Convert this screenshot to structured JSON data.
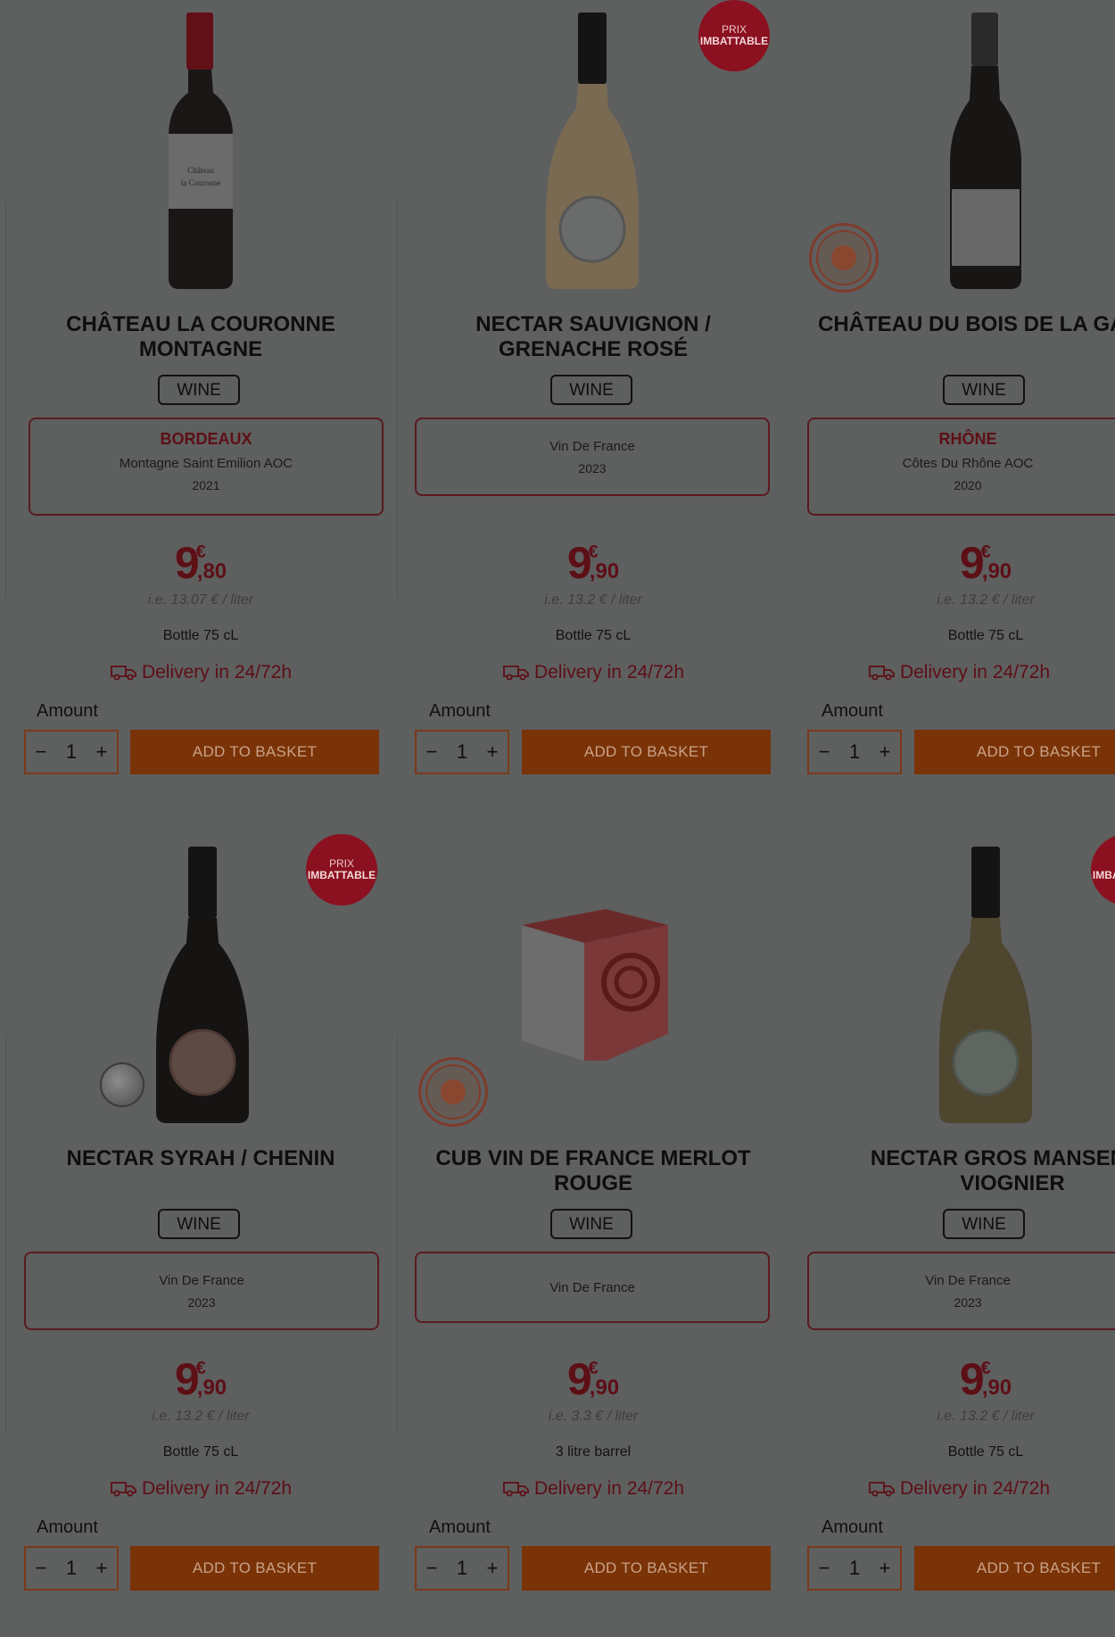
{
  "colors": {
    "overlay_bg": "#5e5f5f",
    "brand_red": "#5d0f16",
    "button_orange": "#7a3207",
    "badge_red": "#8b1020"
  },
  "badge": {
    "line1": "PRIX",
    "line2": "IMBATTABLE"
  },
  "amount_label": "Amount",
  "add_to_basket": "ADD TO BASKET",
  "delivery_text": "Delivery in 24/72h",
  "currency": "€",
  "products": [
    {
      "title": "CHÂTEAU LA COURONNE\nMONTAGNE",
      "category": "WINE",
      "region": "BORDEAUX",
      "appellation": "Montagne Saint Emilion AOC",
      "vintage": "2021",
      "price_euros": "9",
      "price_cents": ",80",
      "per_liter": "i.e. 13.07 € / liter",
      "size": "Bottle 75 cL",
      "quantity": "1"
    },
    {
      "title": "NECTAR SAUVIGNON /\nGRENACHE ROSÉ",
      "category": "WINE",
      "region": "",
      "appellation": "Vin De France",
      "vintage": "2023",
      "price_euros": "9",
      "price_cents": ",90",
      "per_liter": "i.e. 13.2 € / liter",
      "size": "Bottle 75 cL",
      "quantity": "1"
    },
    {
      "title": "CHÂTEAU DU BOIS DE LA GAR",
      "category": "WINE",
      "region": "RHÔNE",
      "appellation": "Côtes Du Rhône AOC",
      "vintage": "2020",
      "price_euros": "9",
      "price_cents": ",90",
      "per_liter": "i.e. 13.2 € / liter",
      "size": "Bottle 75 cL",
      "quantity": "1"
    },
    {
      "title": "NECTAR SYRAH / CHENIN",
      "category": "WINE",
      "region": "",
      "appellation": "Vin De France",
      "vintage": "2023",
      "price_euros": "9",
      "price_cents": ",90",
      "per_liter": "i.e. 13.2 € / liter",
      "size": "Bottle 75 cL",
      "quantity": "1"
    },
    {
      "title": "CUB VIN DE FRANCE MERLOT\nROUGE",
      "category": "WINE",
      "region": "",
      "appellation": "Vin De France",
      "vintage": "",
      "price_euros": "9",
      "price_cents": ",90",
      "per_liter": "i.e. 3.3 € / liter",
      "size": "3 litre barrel",
      "quantity": "1"
    },
    {
      "title": "NECTAR GROS MANSENG /\nVIOGNIER",
      "category": "WINE",
      "region": "",
      "appellation": "Vin De France",
      "vintage": "2023",
      "price_euros": "9",
      "price_cents": ",90",
      "per_liter": "i.e. 13.2 € / liter",
      "size": "Bottle 75 cL",
      "quantity": "1"
    }
  ]
}
